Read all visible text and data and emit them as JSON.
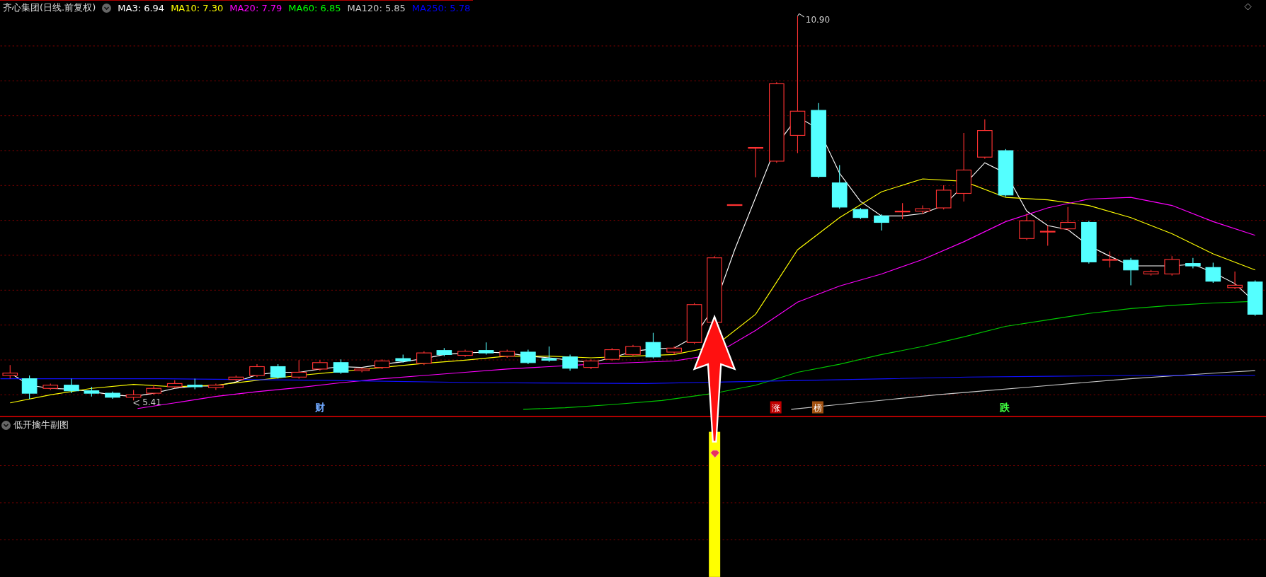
{
  "main_chart": {
    "title": "齐心集团(日线.前复权)",
    "moving_averages": [
      {
        "label": "MA3: 6.94",
        "color": "#ffffff"
      },
      {
        "label": "MA10: 7.30",
        "color": "#ffff00"
      },
      {
        "label": "MA20: 7.79",
        "color": "#ff00ff"
      },
      {
        "label": "MA60: 6.85",
        "color": "#00ff00"
      },
      {
        "label": "MA120: 5.85",
        "color": "#c8c8c8"
      },
      {
        "label": "MA250: 5.78",
        "color": "#0000ff"
      }
    ],
    "high_label": "10.90",
    "low_label": "5.41",
    "markers": [
      {
        "text": "财",
        "kind": "text",
        "color": "#6fa8ff"
      },
      {
        "text": "涨",
        "kind": "badge",
        "color": "#c00000"
      },
      {
        "text": "榜",
        "kind": "badge",
        "color": "#a05010"
      },
      {
        "text": "跌",
        "kind": "text",
        "color": "#40ff40"
      }
    ]
  },
  "sub_chart": {
    "title": "低开擒牛副图"
  }
}
